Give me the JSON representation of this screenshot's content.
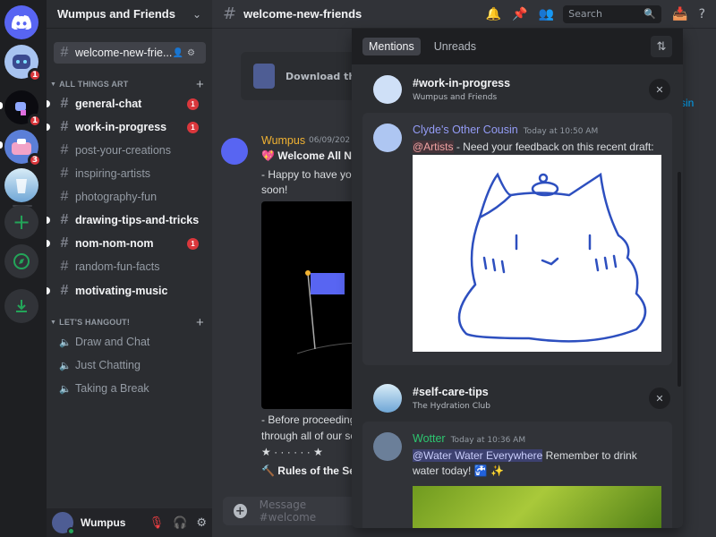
{
  "rail": {
    "badges": [
      "1",
      "1",
      "3"
    ]
  },
  "sidebar": {
    "guild_name": "Wumpus and Friends",
    "pinned_channel": "welcome-new-frie...",
    "categories": [
      {
        "name": "ALL THINGS ART",
        "channels": [
          {
            "name": "general-chat",
            "unread": true,
            "mentions": "1"
          },
          {
            "name": "work-in-progress",
            "unread": true,
            "mentions": "1"
          },
          {
            "name": "post-your-creations",
            "unread": false
          },
          {
            "name": "inspiring-artists",
            "unread": false
          },
          {
            "name": "photography-fun",
            "unread": false
          },
          {
            "name": "drawing-tips-and-tricks",
            "unread": true
          },
          {
            "name": "nom-nom-nom",
            "unread": true,
            "mentions": "1"
          },
          {
            "name": "random-fun-facts",
            "unread": false
          },
          {
            "name": "motivating-music",
            "unread": true
          }
        ]
      },
      {
        "name": "LET'S HANGOUT!",
        "channels": [
          {
            "name": "Draw and Chat"
          },
          {
            "name": "Just Chatting"
          },
          {
            "name": "Taking a Break"
          }
        ]
      }
    ],
    "user": {
      "name": "Wumpus"
    }
  },
  "topbar": {
    "channel": "welcome-new-friends",
    "search_placeholder": "Search"
  },
  "chat": {
    "download_card": "Download the D",
    "author": "Wumpus",
    "date": "06/09/202",
    "lines": [
      "💖 Welcome All N",
      "- Happy to have you",
      "soon!",
      "- Before proceeding",
      "through all of our se",
      "★ · · · · · · ★",
      "🔨 Rules of the Ser"
    ],
    "composer_placeholder": "Message #welcome",
    "overflow_link": "sin"
  },
  "mentions": {
    "tabs": [
      "Mentions",
      "Unreads"
    ],
    "groups": [
      {
        "channel": "#work-in-progress",
        "server": "Wumpus and Friends",
        "message": {
          "author": "Clyde's Other Cousin",
          "author_color": "#949cf7",
          "time": "Today at 10:50 AM",
          "mention": "@Artists",
          "text": " - Need your feedback on this recent draft:"
        }
      },
      {
        "channel": "#self-care-tips",
        "server": "The Hydration Club",
        "message": {
          "author": "Wotter",
          "author_color": "#2dc770",
          "time": "Today at 10:36 AM",
          "mention": "@Water Water Everywhere",
          "text": " Remember to drink water today! 🚰 ✨"
        }
      }
    ]
  },
  "colors": {
    "accent": "#5865f2",
    "mention_badge": "#da373c",
    "online": "#23a559"
  }
}
